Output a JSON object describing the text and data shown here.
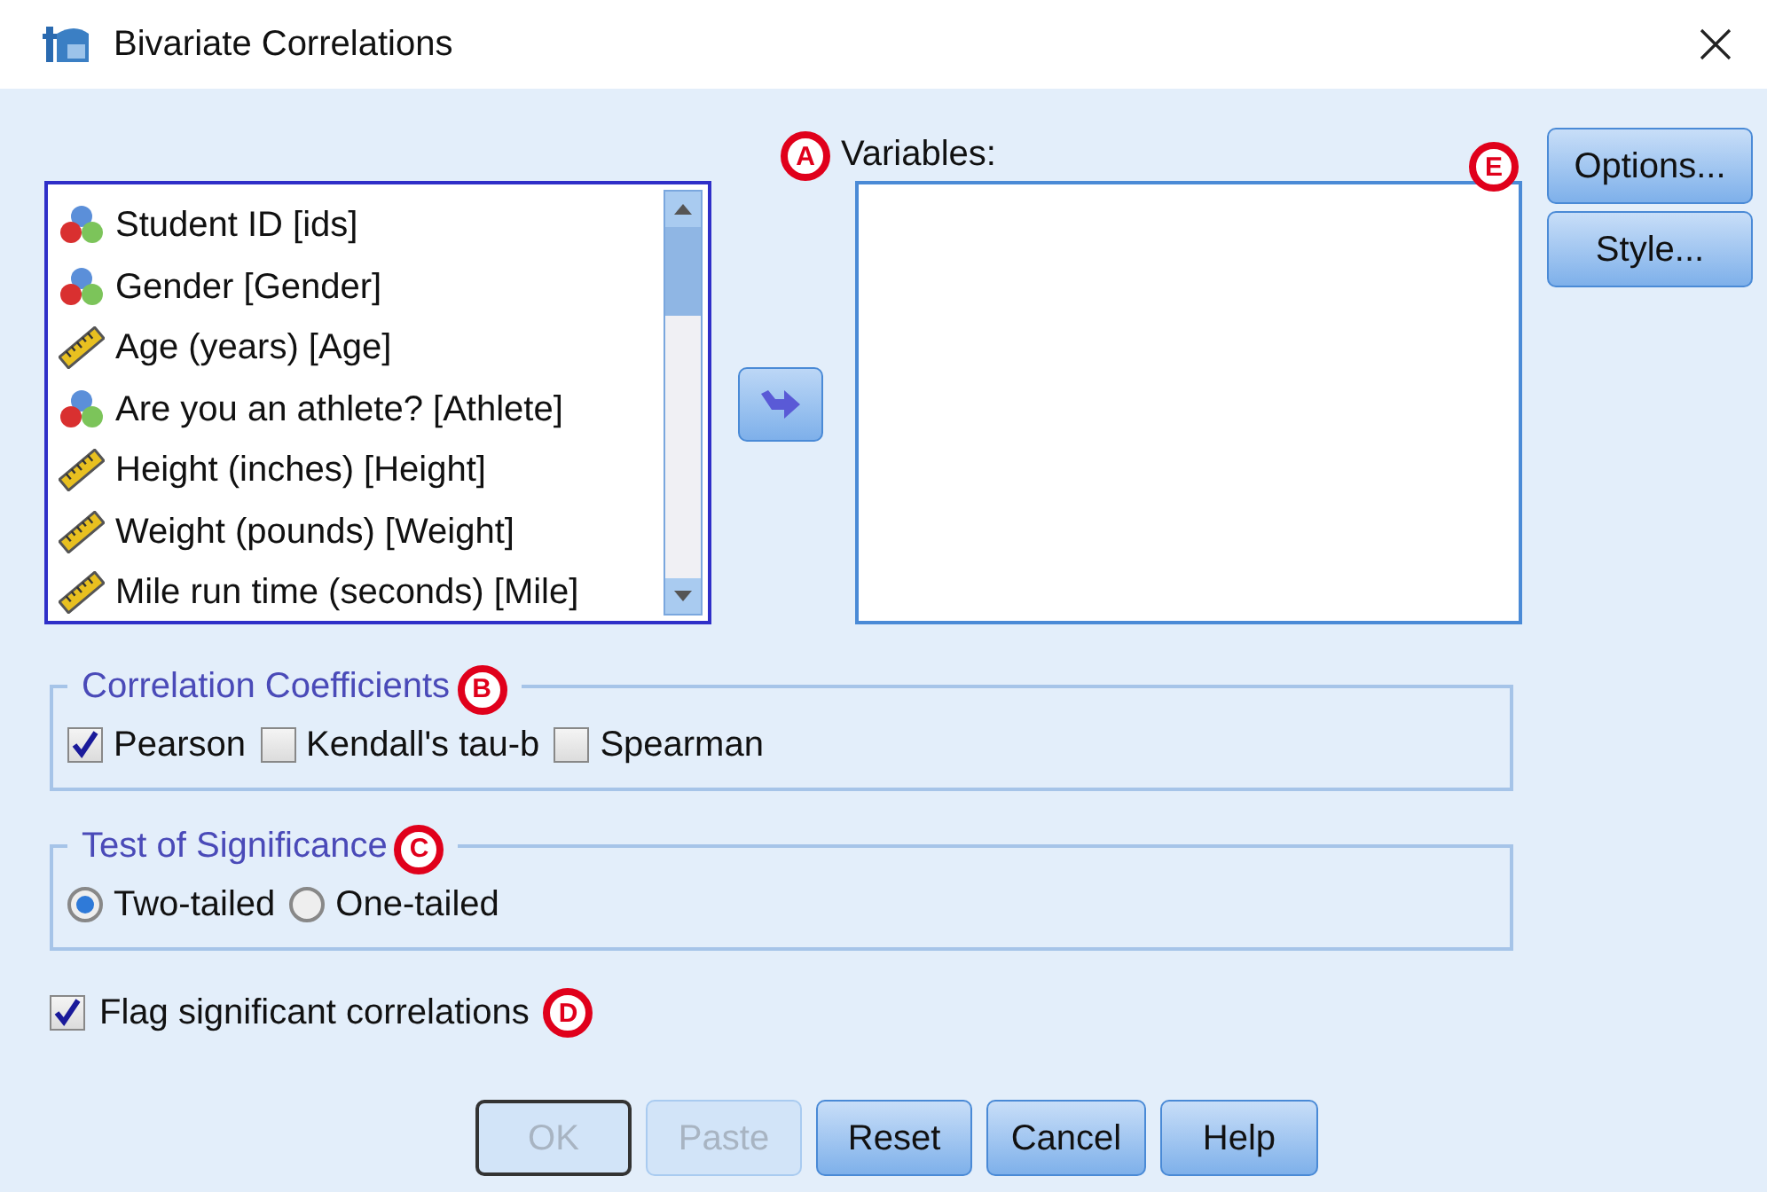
{
  "window": {
    "title": "Bivariate Correlations"
  },
  "source_list": {
    "items": [
      {
        "label": "Student ID [ids]",
        "kind": "nominal"
      },
      {
        "label": "Gender [Gender]",
        "kind": "nominal"
      },
      {
        "label": "Age (years) [Age]",
        "kind": "scale"
      },
      {
        "label": "Are you an athlete? [Athlete]",
        "kind": "nominal"
      },
      {
        "label": "Height (inches) [Height]",
        "kind": "scale"
      },
      {
        "label": "Weight (pounds) [Weight]",
        "kind": "scale"
      },
      {
        "label": "Mile run time (seconds) [Mile]",
        "kind": "scale"
      }
    ]
  },
  "variables": {
    "label": "Variables:",
    "marker": "A"
  },
  "side_buttons": [
    {
      "label": "Options...",
      "marker": "E"
    },
    {
      "label": "Style..."
    }
  ],
  "correlation_coefficients": {
    "title": "Correlation Coefficients",
    "marker": "B",
    "options": [
      {
        "label": "Pearson",
        "checked": true
      },
      {
        "label": "Kendall's tau-b",
        "checked": false
      },
      {
        "label": "Spearman",
        "checked": false
      }
    ]
  },
  "test_of_significance": {
    "title": "Test of Significance",
    "marker": "C",
    "options": [
      {
        "label": "Two-tailed",
        "selected": true
      },
      {
        "label": "One-tailed",
        "selected": false
      }
    ]
  },
  "flag": {
    "label": "Flag significant correlations",
    "checked": true,
    "marker": "D"
  },
  "buttons": [
    {
      "label": "OK",
      "disabled": true,
      "default": true
    },
    {
      "label": "Paste",
      "disabled": true,
      "default": false
    },
    {
      "label": "Reset",
      "disabled": false,
      "default": false
    },
    {
      "label": "Cancel",
      "disabled": false,
      "default": false
    },
    {
      "label": "Help",
      "disabled": false,
      "default": false
    }
  ]
}
